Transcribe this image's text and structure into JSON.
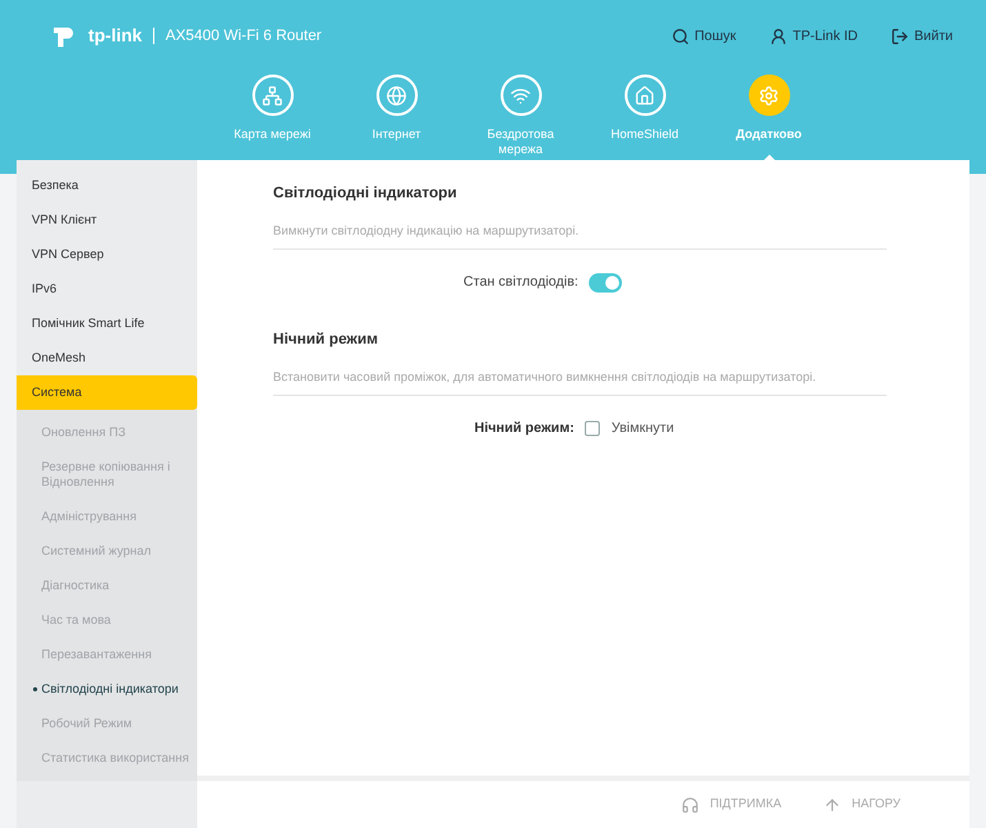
{
  "header": {
    "brand": "tp-link",
    "model": "AX5400 Wi-Fi 6 Router",
    "links": [
      {
        "kind": "search",
        "label": "Пошук"
      },
      {
        "kind": "id",
        "label": "TP-Link ID"
      },
      {
        "kind": "logout",
        "label": "Вийти"
      }
    ]
  },
  "nav": [
    {
      "kind": "map",
      "label": "Карта мережі",
      "selected": false
    },
    {
      "kind": "globe",
      "label": "Інтернет",
      "selected": false
    },
    {
      "kind": "wifi",
      "label": "Бездротова мережа",
      "selected": false
    },
    {
      "kind": "shield",
      "label": "HomeShield",
      "selected": false
    },
    {
      "kind": "gear",
      "label": "Додатково",
      "selected": true
    }
  ],
  "sidebar": {
    "items": [
      {
        "label": "Безпека",
        "selected": false
      },
      {
        "label": "VPN Клієнт",
        "selected": false
      },
      {
        "label": "VPN Сервер",
        "selected": false
      },
      {
        "label": "IPv6",
        "selected": false
      },
      {
        "label": "Помічник Smart Life",
        "selected": false
      },
      {
        "label": "OneMesh",
        "selected": false
      },
      {
        "label": "Система",
        "selected": true,
        "expanded": true,
        "children": [
          {
            "label": "Оновлення ПЗ",
            "selected": false
          },
          {
            "label": "Резервне копіювання і Відновлення",
            "selected": false
          },
          {
            "label": "Адміністрування",
            "selected": false
          },
          {
            "label": "Системний журнал",
            "selected": false
          },
          {
            "label": "Діагностика",
            "selected": false
          },
          {
            "label": "Час та мова",
            "selected": false
          },
          {
            "label": "Перезавантаження",
            "selected": false
          },
          {
            "label": "Світлодіодні індикатори",
            "selected": true
          },
          {
            "label": "Робочий Режим",
            "selected": false
          },
          {
            "label": "Статистика використання",
            "selected": false
          }
        ]
      }
    ]
  },
  "sections": [
    {
      "title": "Світлодіодні індикатори",
      "description": "Вимкнути світлодіодну індикацію на маршрутизаторі.",
      "field": {
        "kind": "toggle",
        "label": "Стан світлодіодів:",
        "on": true
      }
    },
    {
      "title": "Нічний режим",
      "description": "Встановити часовий проміжок, для автоматичного вимкнення світлодіодів на маршрутизаторі.",
      "field": {
        "kind": "checkbox",
        "label": "Нічний режим:",
        "option": "Увімкнути",
        "checked": false
      }
    }
  ],
  "footer": [
    {
      "kind": "support",
      "label": "ПІДТРИМКА"
    },
    {
      "kind": "top",
      "label": "НАГОРУ"
    }
  ]
}
